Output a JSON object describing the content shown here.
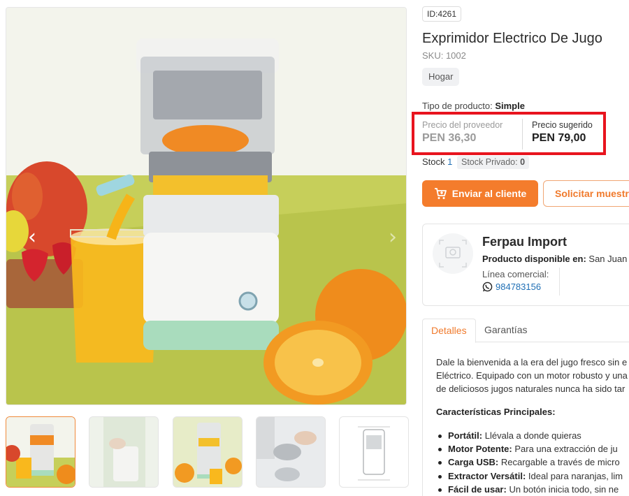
{
  "gallery": {
    "prev_arrow": "‹",
    "next_arrow": "›",
    "thumbnails": [
      "thumb-1",
      "thumb-2",
      "thumb-3",
      "thumb-4",
      "thumb-5"
    ],
    "active_thumbnail": 0
  },
  "product": {
    "id_badge": "ID:4261",
    "title": "Exprimidor Electrico De Jugo",
    "sku": "SKU: 1002",
    "category": "Hogar",
    "type_label": "Tipo de producto:",
    "type_value": "Simple"
  },
  "pricing": {
    "provider_label": "Precio del proveedor",
    "provider_value": "PEN 36,30",
    "suggested_label": "Precio sugerido",
    "suggested_value": "PEN 79,00",
    "highlight_color": "#e8141e"
  },
  "stock": {
    "label": "Stock",
    "value": "1",
    "private_label": "Stock Privado:",
    "private_value": "0"
  },
  "actions": {
    "send_label": "Enviar al cliente",
    "sample_label": "Solicitar muestra",
    "accent_color": "#f47c2c"
  },
  "supplier": {
    "name": "Ferpau Import",
    "location_label": "Producto disponible en:",
    "location_value": "San Juan D",
    "line_label": "Línea comercial:",
    "phone": "984783156"
  },
  "tabs": {
    "details": "Detalles",
    "warranty": "Garantías"
  },
  "details": {
    "desc_line1": "Dale la bienvenida a la era del jugo fresco sin e",
    "desc_line2": "Eléctrico. Equipado con un motor robusto y una",
    "desc_line3": "de deliciosos jugos naturales nunca ha sido tar",
    "features_heading": "Características Principales:",
    "features": [
      {
        "name": "Portátil:",
        "text": "Llévala a donde quieras"
      },
      {
        "name": "Motor Potente:",
        "text": "Para una extracción de ju"
      },
      {
        "name": "Carga USB:",
        "text": "Recargable a través de micro"
      },
      {
        "name": "Extractor Versátil:",
        "text": "Ideal para naranjas, lim"
      },
      {
        "name": "Fácil de usar:",
        "text": "Un botón inicia todo, sin ne"
      }
    ]
  }
}
